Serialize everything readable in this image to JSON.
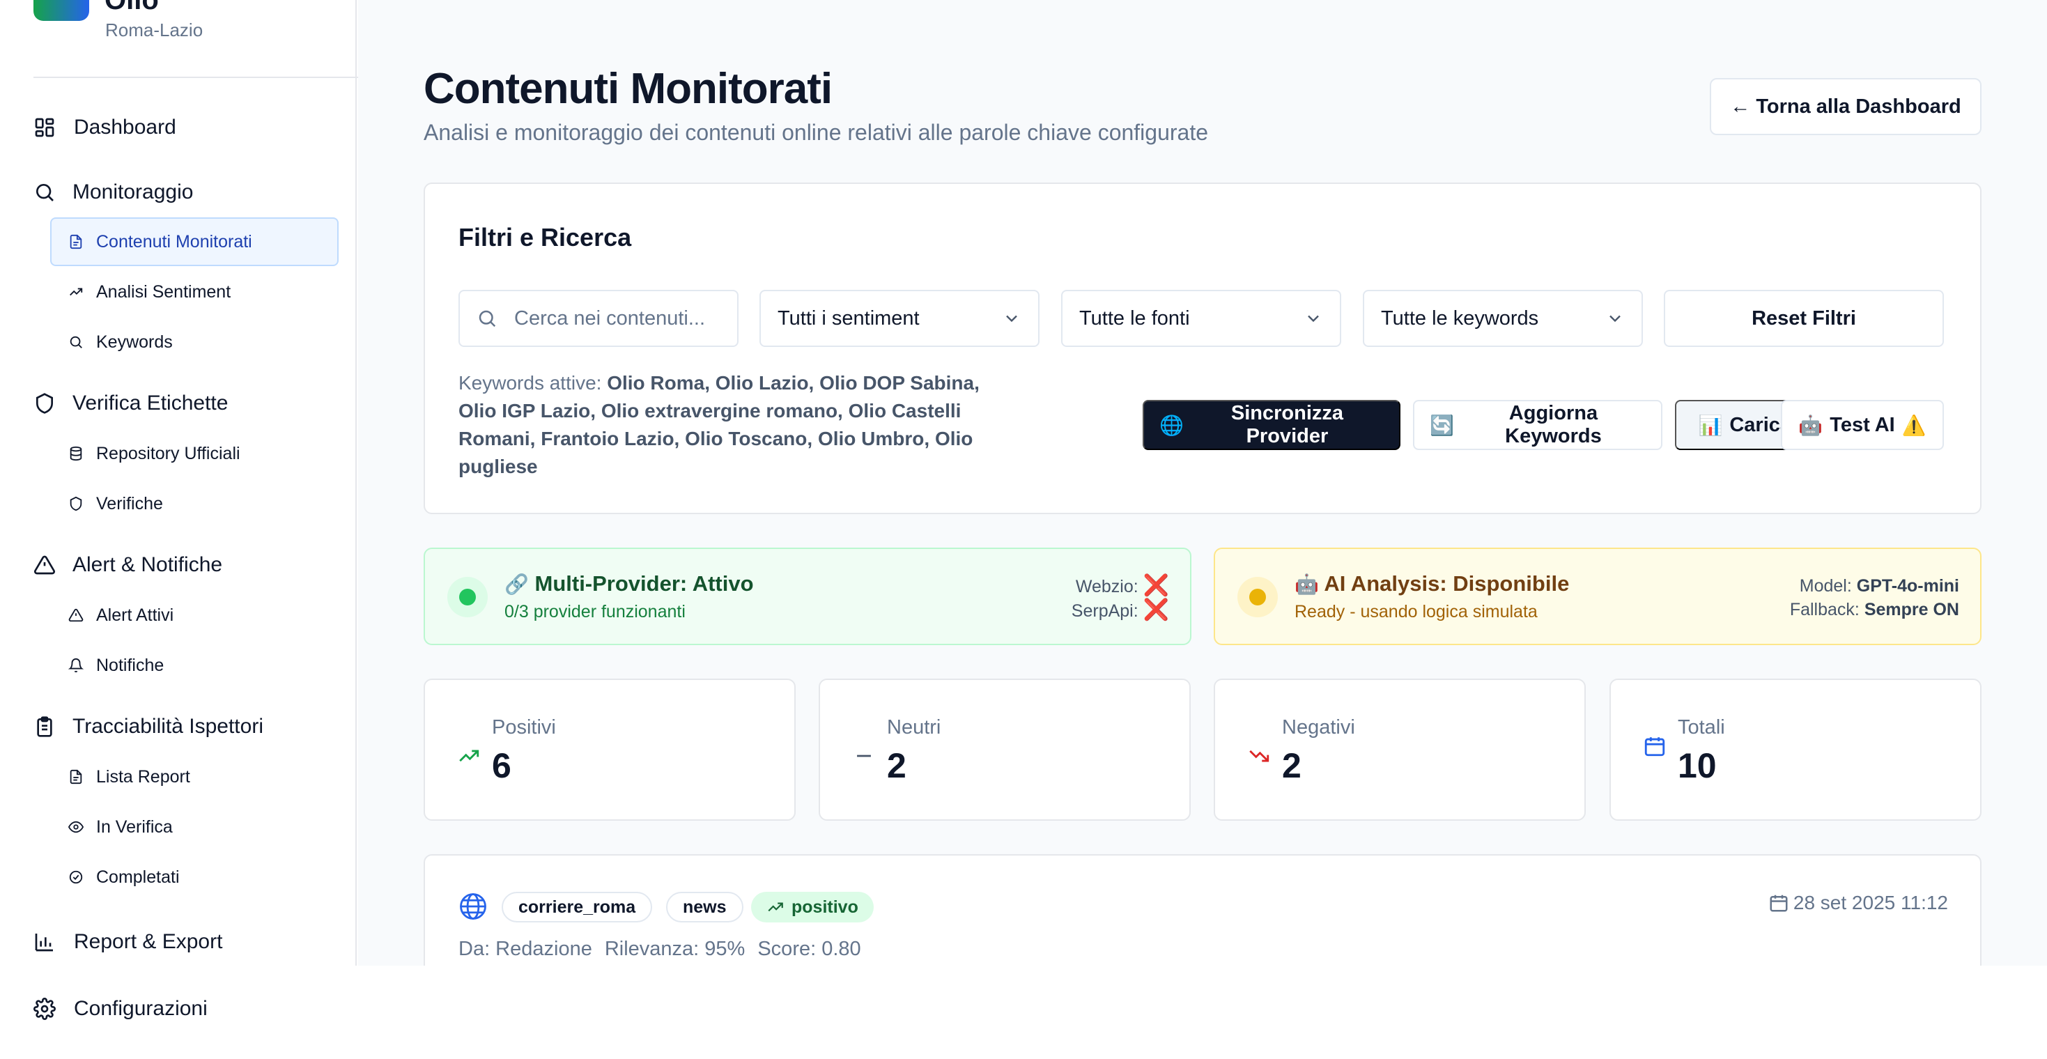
{
  "brand": {
    "name": "Olio",
    "region": "Roma-Lazio"
  },
  "sidebar": {
    "dashboard": "Dashboard",
    "groups": {
      "monitoraggio": {
        "label": "Monitoraggio",
        "items": [
          "Contenuti Monitorati",
          "Analisi Sentiment",
          "Keywords"
        ]
      },
      "verifica": {
        "label": "Verifica Etichette",
        "items": [
          "Repository Ufficiali",
          "Verifiche"
        ]
      },
      "alert": {
        "label": "Alert & Notifiche",
        "items": [
          "Alert Attivi",
          "Notifiche"
        ]
      },
      "tracciabilita": {
        "label": "Tracciabilità Ispettori",
        "items": [
          "Lista Report",
          "In Verifica",
          "Completati"
        ]
      }
    },
    "report": "Report & Export",
    "config": "Configurazioni"
  },
  "header": {
    "title": "Contenuti Monitorati",
    "subtitle": "Analisi e monitoraggio dei contenuti online relativi alle parole chiave configurate",
    "back_label": "← Torna alla Dashboard"
  },
  "filters": {
    "title": "Filtri e Ricerca",
    "search_placeholder": "Cerca nei contenuti...",
    "sentiment_select": "Tutti i sentiment",
    "sources_select": "Tutte le fonti",
    "keywords_select": "Tutte le keywords",
    "reset_label": "Reset Filtri",
    "keywords_prefix": "Keywords attive:",
    "keywords_list": "Olio Roma, Olio Lazio, Olio DOP Sabina, Olio IGP Lazio, Olio extravergine romano, Olio Castelli Romani, Frantoio Lazio, Olio Toscano, Olio Umbro, Olio pugliese",
    "actions": {
      "sync": {
        "emoji": "🌐",
        "label": "Sincronizza Provider"
      },
      "update": {
        "emoji": "🔄",
        "label": "Aggiorna Keywords"
      },
      "demo": {
        "emoji": "📊",
        "label": "Carica Dati Demo"
      },
      "test": {
        "emoji": "🤖",
        "label": "Test AI",
        "warn": "⚠️"
      }
    }
  },
  "status": {
    "provider": {
      "emoji": "🔗",
      "title": "Multi-Provider: Attivo",
      "subtitle": "0/3 provider funzionanti",
      "webzio_label": "Webzio:",
      "serpapi_label": "SerpApi:",
      "fail_mark": "❌"
    },
    "ai": {
      "emoji": "🤖",
      "title": "AI Analysis: Disponibile",
      "subtitle": "Ready - usando logica simulata",
      "model_label": "Model:",
      "model_value": "GPT-4o-mini",
      "fallback_label": "Fallback:",
      "fallback_value": "Sempre ON"
    }
  },
  "stats": {
    "positivi": {
      "label": "Positivi",
      "value": "6"
    },
    "neutri": {
      "label": "Neutri",
      "value": "2"
    },
    "negativi": {
      "label": "Negativi",
      "value": "2"
    },
    "totali": {
      "label": "Totali",
      "value": "10"
    }
  },
  "content_item": {
    "source": "corriere_roma",
    "type": "news",
    "sentiment": "positivo",
    "date": "28 set 2025 11:12",
    "author": "Da: Redazione",
    "relevance": "Rilevanza: 95%",
    "score": "Score: 0.80"
  },
  "colors": {
    "primary_dark": "#0f172a",
    "active_bg": "#eff6ff",
    "active_text": "#1e40af",
    "positive": "#16a34a",
    "negative": "#dc2626",
    "info": "#2563eb"
  }
}
